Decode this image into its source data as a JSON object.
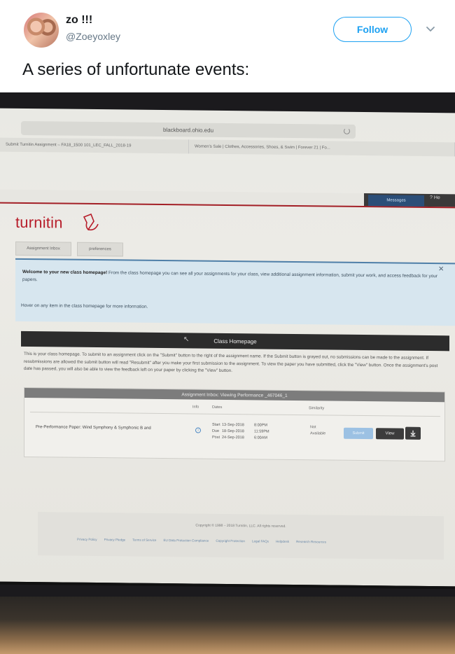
{
  "tweet": {
    "display_name": "zo !!!",
    "handle": "@Zoeyoxley",
    "follow_label": "Follow",
    "text": "A series of unfortunate events:"
  },
  "browser": {
    "url": "blackboard.ohio.edu",
    "tab1": "Submit Turnitin Assignment – FA18_1500 101_LEC_FALL_2018-19",
    "tab2": "Women's Sale | Clothes, Accessories, Shoes, & Swim | Forever 21 | Fo..."
  },
  "blackboard": {
    "messages_label": "Messages",
    "help_label": "? He"
  },
  "turnitin": {
    "logo": "turnitin",
    "tabs": [
      "Assignment Inbox",
      "preferences"
    ],
    "welcome_bold": "Welcome to your new class homepage!",
    "welcome_text": " From the class homepage you can see all your assignments for your class, view additional assignment information, submit your work, and access feedback for your papers.",
    "hover_note": "Hover on any item in the class homepage for more information.",
    "class_homepage": "Class Homepage",
    "intro": "This is your class homepage. To submit to an assignment click on the \"Submit\" button to the right of the assignment name. If the Submit button is grayed out, no submissions can be made to the assignment. If resubmissions are allowed the submit button will read \"Resubmit\" after you make your first submission to the assignment. To view the paper you have submitted, click the \"View\" button. Once the assignment's post date has passed, you will also be able to view the feedback left on your paper by clicking the \"View\" button.",
    "inbox_header": "Assignment Inbox: Viewing Performance _467046_1",
    "columns": {
      "info": "Info",
      "dates": "Dates",
      "similarity": "Similarity"
    },
    "assignment": {
      "title": "Pre-Performance Paper: Wind Symphony & Symphonic B and",
      "dates": [
        {
          "label": "Start",
          "date": "13-Sep-2018",
          "time": "8:00PM"
        },
        {
          "label": "Due",
          "date": "18-Sep-2018",
          "time": "11:59PM"
        },
        {
          "label": "Post",
          "date": "24-Sep-2018",
          "time": "6:00AM"
        }
      ],
      "similarity": "Not Available",
      "submit_label": "Submit",
      "view_label": "View"
    },
    "copyright": "Copyright © 1998 – 2018 Turnitin, LLC. All rights reserved.",
    "footer_links": [
      "Privacy Policy",
      "Privacy Pledge",
      "Terms of Service",
      "EU Data Protection Compliance",
      "Copyright Protection",
      "Legal FAQs",
      "Helpdesk",
      "Research Resources"
    ]
  }
}
